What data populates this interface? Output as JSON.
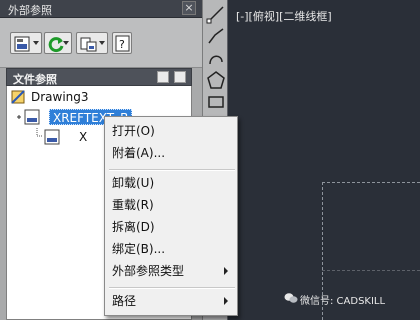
{
  "palette": {
    "title": "外部参照",
    "close_glyph": "×",
    "toolbar": {
      "attach_icon_text": "DWG"
    },
    "section_title": "文件参照",
    "tree": {
      "root_label": "Drawing3",
      "selected_label": "XREFTEXT_B",
      "child_label": "X",
      "xref_icon_text": "DWG"
    }
  },
  "canvas": {
    "viewport_label": "[-][俯视][二维线框]",
    "watermark_text": "微信号: CADSKILL"
  },
  "context_menu": {
    "items": [
      {
        "label": "打开(O)",
        "submenu": false
      },
      {
        "label": "附着(A)...",
        "submenu": false
      },
      {
        "label": "卸载(U)",
        "submenu": false
      },
      {
        "label": "重载(R)",
        "submenu": false
      },
      {
        "label": "拆离(D)",
        "submenu": false
      },
      {
        "label": "绑定(B)...",
        "submenu": false
      },
      {
        "label": "外部参照类型",
        "submenu": true
      },
      {
        "label": "路径",
        "submenu": true
      }
    ]
  },
  "colors": {
    "selection": "#2f7fd8",
    "canvas_background": "#2a2f38",
    "palette_background": "#a9aaab"
  }
}
